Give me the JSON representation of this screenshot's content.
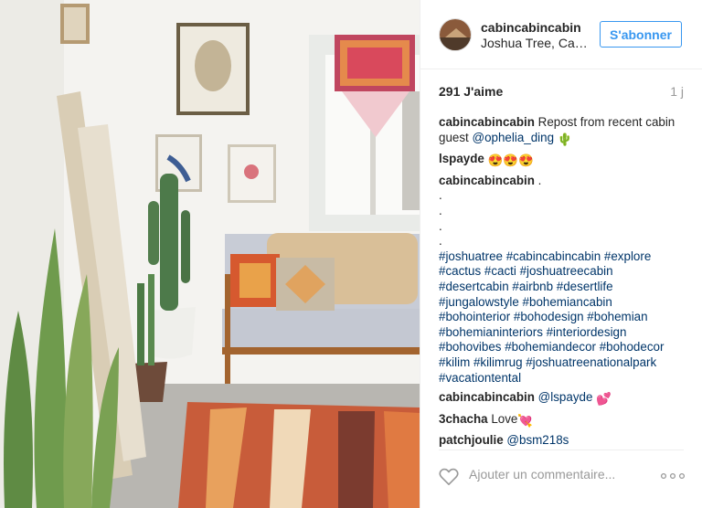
{
  "header": {
    "username": "cabincabincabin",
    "location": "Joshua Tree, California",
    "follow_label": "S'abonner"
  },
  "stats": {
    "likes": "291 J'aime",
    "time_ago": "1 j"
  },
  "comments": [
    {
      "user": "cabincabincabin",
      "text": "Repost from recent cabin guest",
      "mention": "@ophelia_ding",
      "emoji": "🌵"
    },
    {
      "user": "lspayde",
      "text": "",
      "emoji": "😍😍😍"
    },
    {
      "user": "cabincabincabin",
      "text": ".",
      "dots": [
        ".",
        ".",
        ".",
        "."
      ],
      "hashtags": [
        "#joshuatree #cabincabincabin #explore",
        "#cactus #cacti #joshuatreecabin",
        "#desertcabin #airbnb #desertlife",
        "#jungalowstyle #bohemiancabin",
        "#bohointerior #bohodesign #bohemian",
        "#bohemianinteriors #interiordesign",
        "#bohovibes #bohemiandecor #bohodecor",
        "#kilim #kilimrug #joshuatreenationalpark",
        "#vacationtental"
      ]
    },
    {
      "user": "cabincabincabin",
      "mention": "@lspayde",
      "emoji": "💕"
    },
    {
      "user": "3chacha",
      "text": "Love",
      "emoji": "💘"
    },
    {
      "user": "patchjoulie",
      "mention": "@bsm218s"
    }
  ],
  "footer": {
    "comment_placeholder": "Ajouter un commentaire...",
    "heart_icon": "heart-outline-icon",
    "more_icon": "ellipsis-icon"
  },
  "colors": {
    "follow_blue": "#3897f0",
    "link_blue": "#003569",
    "muted": "#999999"
  }
}
